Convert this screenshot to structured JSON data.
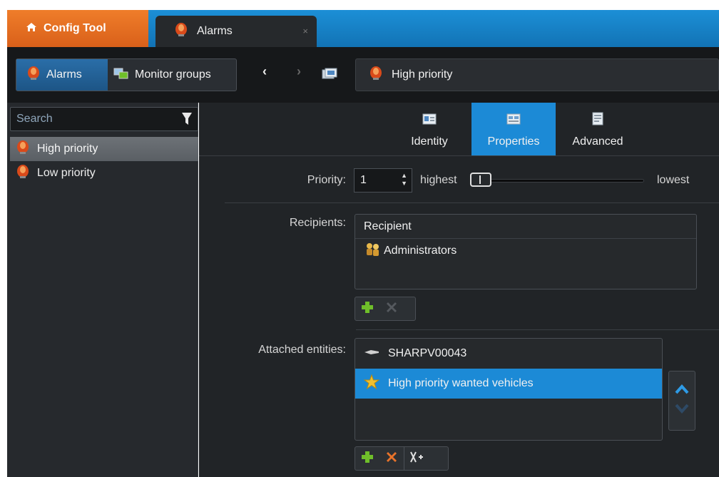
{
  "tabs": {
    "config_tool": "Config Tool",
    "alarms": "Alarms",
    "close_glyph": "×"
  },
  "toolbar": {
    "mode_alarms": "Alarms",
    "mode_monitor_groups": "Monitor groups",
    "back_glyph": "‹",
    "forward_glyph": "›",
    "current_entity": "High priority"
  },
  "left_panel": {
    "search_placeholder": "Search",
    "items": [
      {
        "label": "High priority",
        "selected": true
      },
      {
        "label": "Low priority",
        "selected": false
      }
    ]
  },
  "property_tabs": [
    {
      "label": "Identity",
      "icon": "identity-icon"
    },
    {
      "label": "Properties",
      "icon": "properties-icon",
      "active": true
    },
    {
      "label": "Advanced",
      "icon": "advanced-icon"
    }
  ],
  "properties": {
    "priority_label": "Priority:",
    "priority_value": "1",
    "slider_min_label": "highest",
    "slider_max_label": "lowest",
    "slider_level": 0,
    "recipients_label": "Recipients:",
    "recipients_header": "Recipient",
    "recipients": [
      "Administrators"
    ],
    "attached_label": "Attached entities:",
    "attached": [
      {
        "label": "SHARPV00043",
        "icon": "lpr-camera-icon",
        "selected": false
      },
      {
        "label": "High priority wanted vehicles",
        "icon": "hotlist-icon",
        "selected": true
      }
    ]
  },
  "colors": {
    "accent_blue": "#1c8ad6",
    "config_orange": "#e06a1f",
    "alarm_red": "#d94a1a",
    "add_green": "#6fbf2a",
    "remove_orange": "#e8732a"
  }
}
